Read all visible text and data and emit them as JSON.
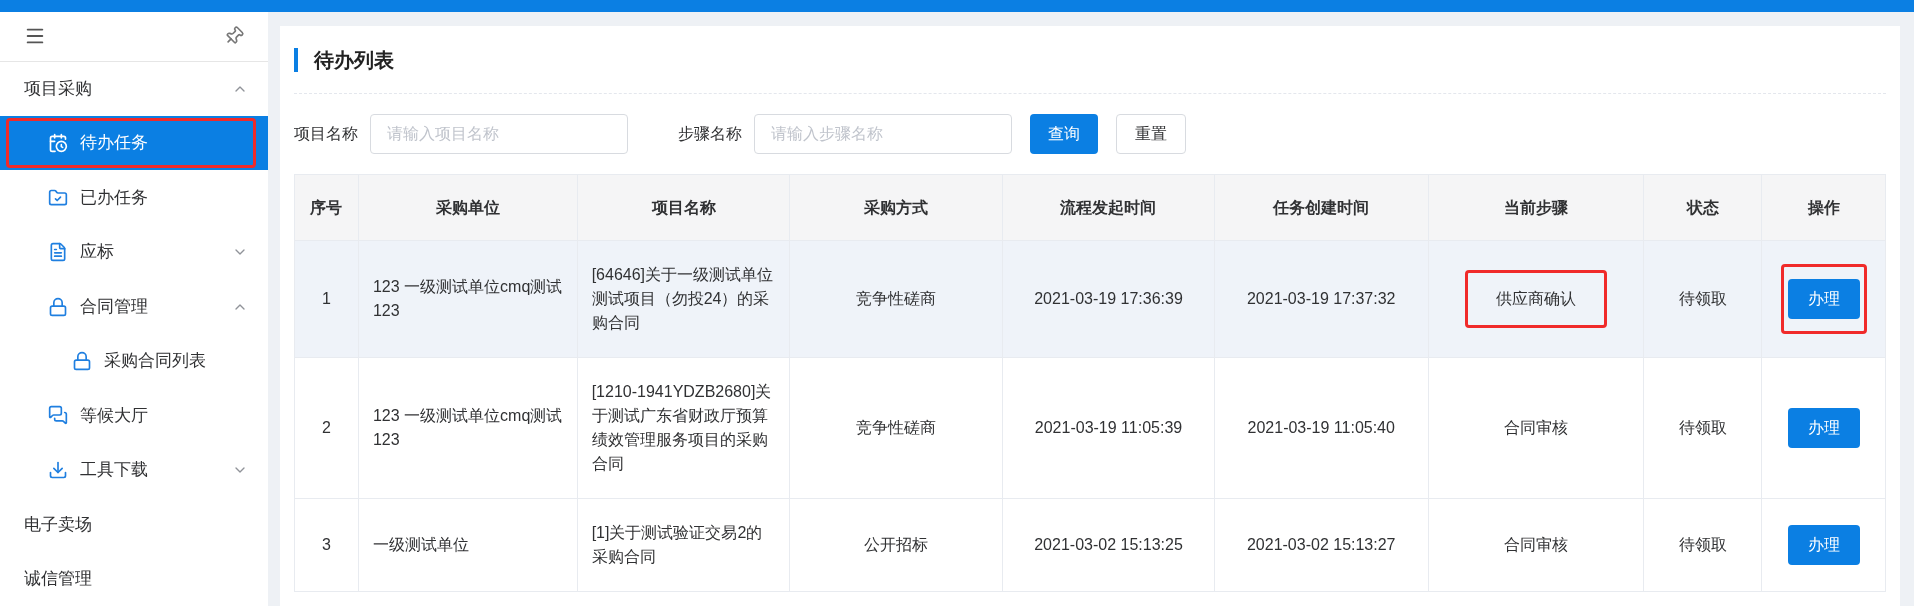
{
  "sidebar": {
    "items": [
      {
        "label": "项目采购",
        "expanded": true,
        "selected": false,
        "annotated": false,
        "children": [
          {
            "label": "待办任务",
            "selected": true,
            "annotated": true
          },
          {
            "label": "已办任务",
            "selected": false,
            "annotated": false
          },
          {
            "label": "应标",
            "expanded": false,
            "selected": false,
            "annotated": false
          },
          {
            "label": "合同管理",
            "expanded": true,
            "selected": false,
            "annotated": false,
            "children": [
              {
                "label": "采购合同列表",
                "selected": false,
                "annotated": false
              }
            ]
          },
          {
            "label": "等候大厅",
            "selected": false,
            "annotated": false
          },
          {
            "label": "工具下载",
            "expanded": false,
            "selected": false,
            "annotated": false
          }
        ]
      },
      {
        "label": "电子卖场",
        "selected": false,
        "annotated": false
      },
      {
        "label": "诚信管理",
        "selected": false,
        "annotated": false
      }
    ]
  },
  "page": {
    "title": "待办列表"
  },
  "filters": [
    {
      "label": "项目名称",
      "placeholder": "请输入项目名称"
    },
    {
      "label": "步骤名称",
      "placeholder": "请输入步骤名称"
    }
  ],
  "buttons": [
    {
      "label": "查询",
      "kind": "primary"
    },
    {
      "label": "重置",
      "kind": "default"
    }
  ],
  "table": {
    "columns": [
      "序号",
      "采购单位",
      "项目名称",
      "采购方式",
      "流程发起时间",
      "任务创建时间",
      "当前步骤",
      "状态",
      "操作"
    ],
    "rows": [
      {
        "cells": [
          "1",
          "123 一级测试单位cmq测试123",
          "[64646]关于一级测试单位测试项目（勿投24）的采购合同",
          "竞争性磋商",
          "2021-03-19 17:36:39",
          "2021-03-19 17:37:32",
          "供应商确认",
          "待领取"
        ],
        "action": "办理",
        "hovered": true,
        "step_annotated": true,
        "action_annotated": true
      },
      {
        "cells": [
          "2",
          "123 一级测试单位cmq测试123",
          "[1210-1941YDZB2680]关于测试广东省财政厅预算绩效管理服务项目的采购合同",
          "竞争性磋商",
          "2021-03-19 11:05:39",
          "2021-03-19 11:05:40",
          "合同审核",
          "待领取"
        ],
        "action": "办理",
        "hovered": false,
        "step_annotated": false,
        "action_annotated": false
      },
      {
        "cells": [
          "3",
          "一级测试单位",
          "[1]关于测试验证交易2的采购合同",
          "公开招标",
          "2021-03-02 15:13:25",
          "2021-03-02 15:13:27",
          "合同审核",
          "待领取"
        ],
        "action": "办理",
        "hovered": false,
        "step_annotated": false,
        "action_annotated": false
      }
    ]
  }
}
